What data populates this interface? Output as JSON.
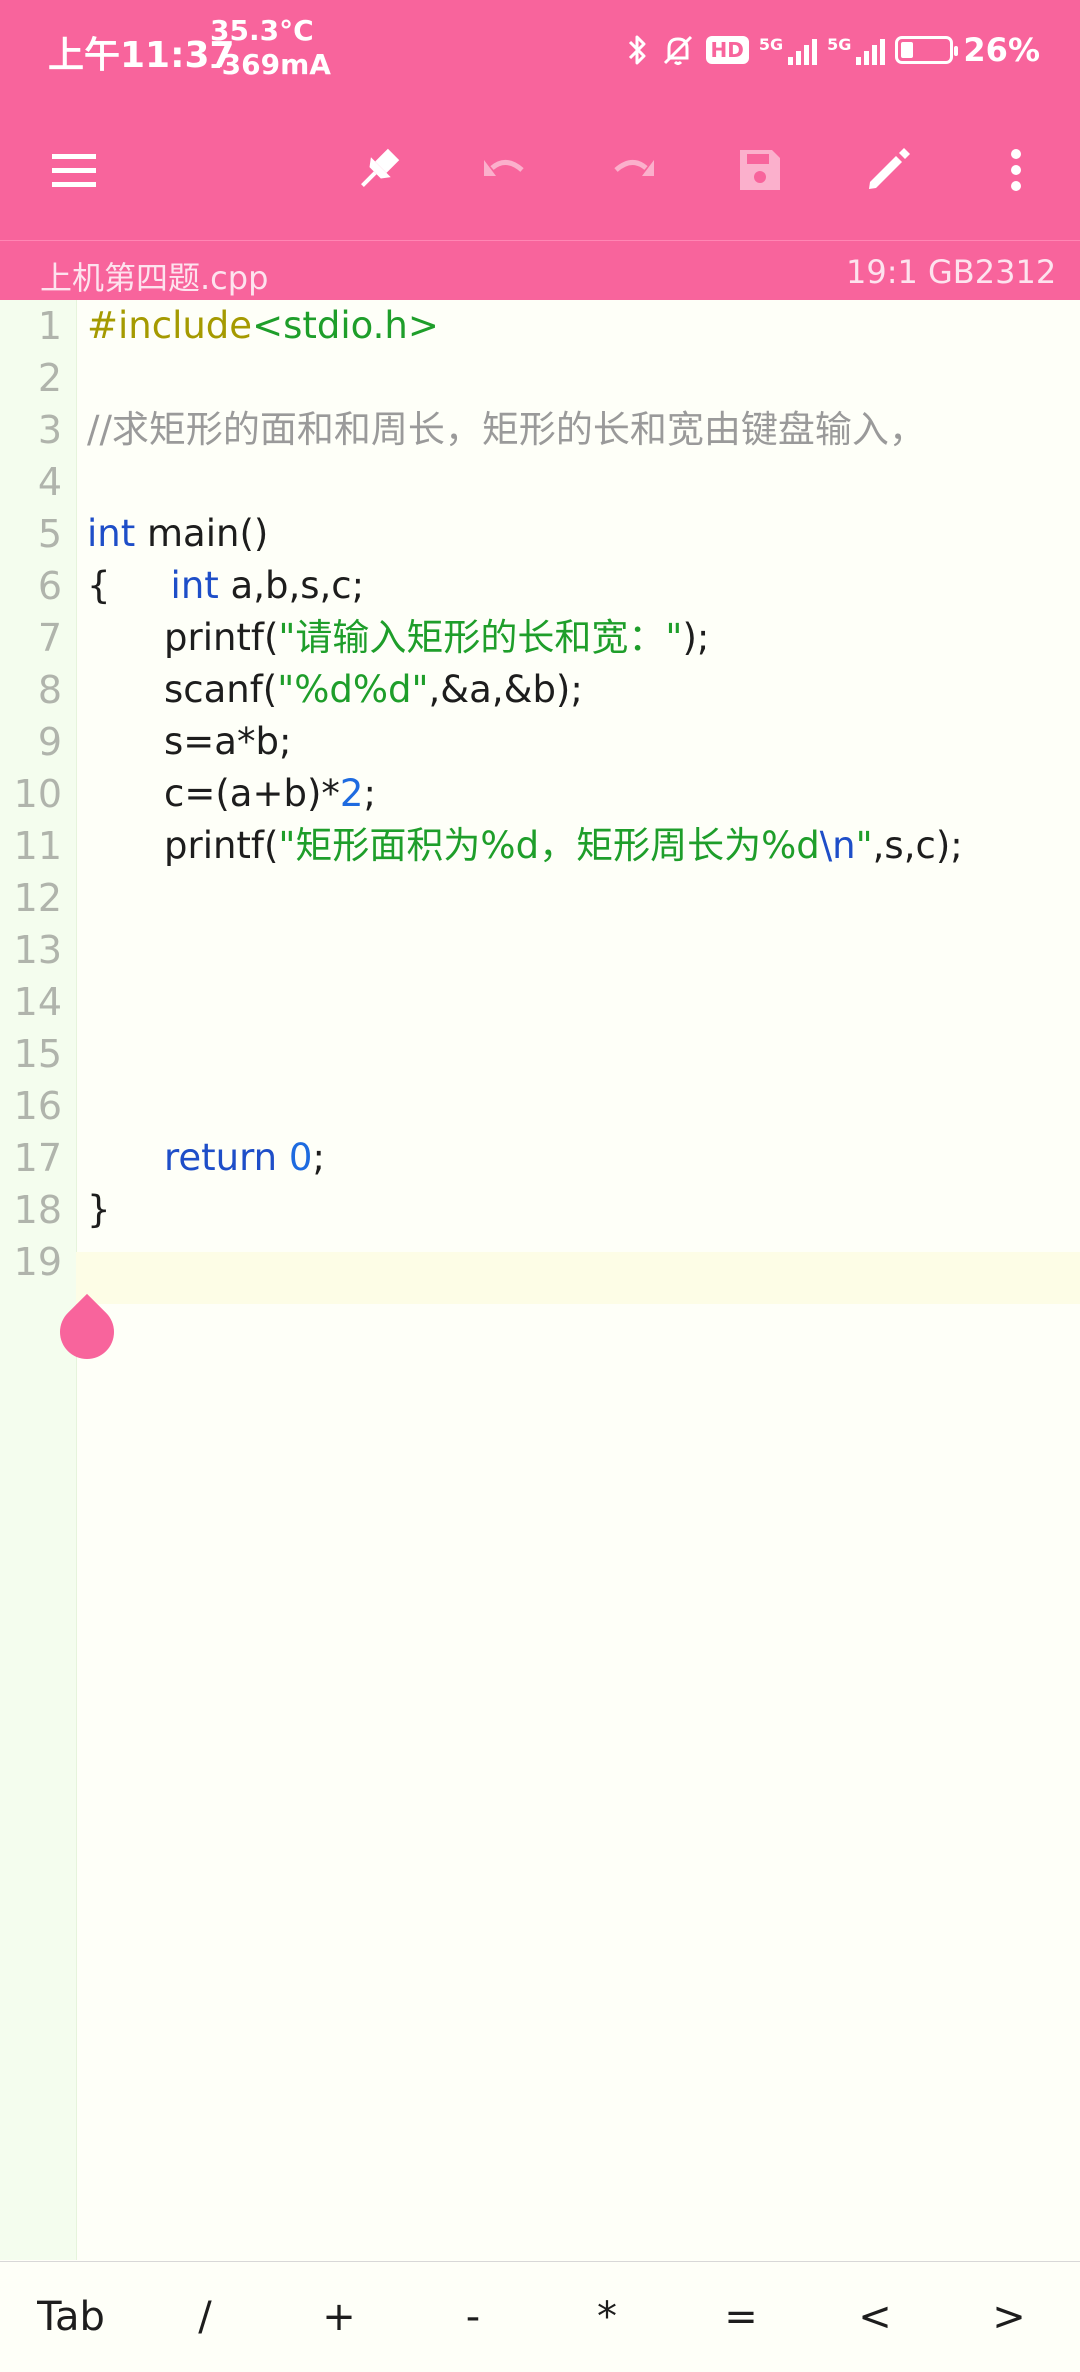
{
  "status_bar": {
    "time": "上午11:37",
    "temperature": "35.3°C",
    "current": "-369mA",
    "hd_label": "HD",
    "signal1_label": "5G",
    "signal2_label": "5G",
    "battery_percent": "26%",
    "battery_level": 0.26
  },
  "toolbar": {
    "menu_icon": "hamburger-menu-icon",
    "pin_icon": "pin-icon",
    "undo_icon": "undo-icon",
    "redo_icon": "redo-icon",
    "save_icon": "save-icon",
    "edit_icon": "pencil-icon",
    "more_icon": "more-vertical-icon"
  },
  "file_bar": {
    "filename": "上机第四题.cpp",
    "cursor_position": "19:1",
    "encoding": "GB2312"
  },
  "editor": {
    "line_numbers": [
      "1",
      "2",
      "3",
      "4",
      "5",
      "6",
      "7",
      "8",
      "9",
      "10",
      "11",
      "12",
      "13",
      "14",
      "15",
      "16",
      "17",
      "18",
      "19"
    ],
    "current_line": 19,
    "code": {
      "l1_directive": "#include",
      "l1_header": "<stdio.h>",
      "l3_comment": "//求矩形的面和和周长，矩形的长和宽由键盘输入，",
      "l5_type": "int",
      "l5_rest": " main()",
      "l6_brace": "{",
      "l6_type": "int",
      "l6_rest": " a,b,s,c;",
      "l7_func": "printf(",
      "l7_str": "\"请输入矩形的长和宽：\"",
      "l7_end": ");",
      "l8_func": "scanf(",
      "l8_str": "\"%d%d\"",
      "l8_end": ",&a,&b);",
      "l9_text": "s=a*b;",
      "l10_text": "c=(a+b)*",
      "l10_num": "2",
      "l10_end": ";",
      "l11_func": "printf(",
      "l11_str": "\"矩形面积为%d，矩形周长为%d",
      "l11_esc": "\\n",
      "l11_strend": "\"",
      "l11_end": ",s,c);",
      "l17_kw": "return",
      "l17_num": "0",
      "l17_end": ";",
      "l18_brace": "}"
    }
  },
  "key_bar": {
    "keys": [
      "Tab",
      "/",
      "+",
      "-",
      "*",
      "=",
      "<",
      ">"
    ]
  },
  "colors": {
    "accent": "#f8649c",
    "keyword": "#1e4ec8",
    "string": "#1e9e2a",
    "comment": "#9a9a9a",
    "preprocessor": "#a59a00"
  }
}
